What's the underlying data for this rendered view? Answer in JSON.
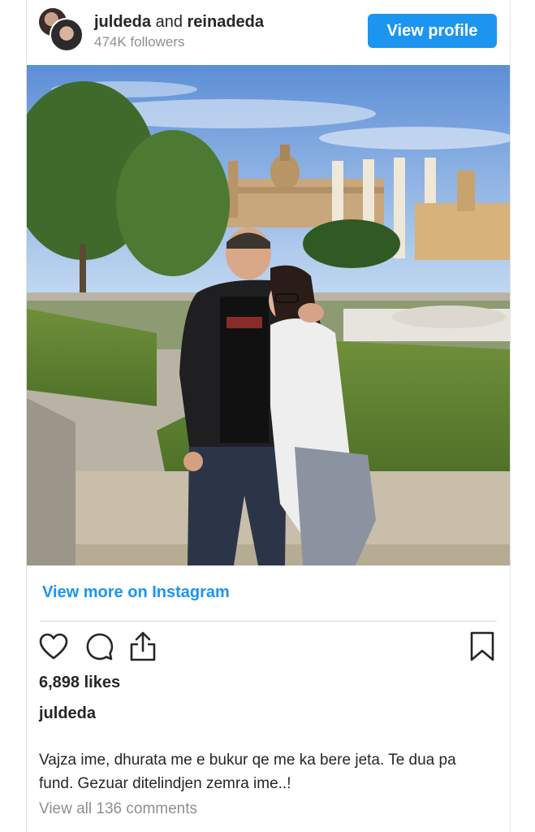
{
  "header": {
    "user1": "juldeda",
    "conjunction": "and",
    "user2": "reinadeda",
    "followers": "474K followers",
    "view_profile_label": "View profile"
  },
  "post": {
    "view_more_label": "View more on Instagram",
    "likes": "6,898 likes",
    "author": "juldeda",
    "caption": "Vajza ime, dhurata me e bukur qe me ka bere jeta. Te dua pa fund. Gezuar ditelindjen zemra ime..!",
    "comments_link": "View all 136 comments"
  },
  "icons": [
    "heart-icon",
    "comment-icon",
    "share-icon",
    "bookmark-icon"
  ],
  "colors": {
    "accent": "#1b95f0",
    "muted_text": "#8e8e8e",
    "text": "#262626"
  }
}
